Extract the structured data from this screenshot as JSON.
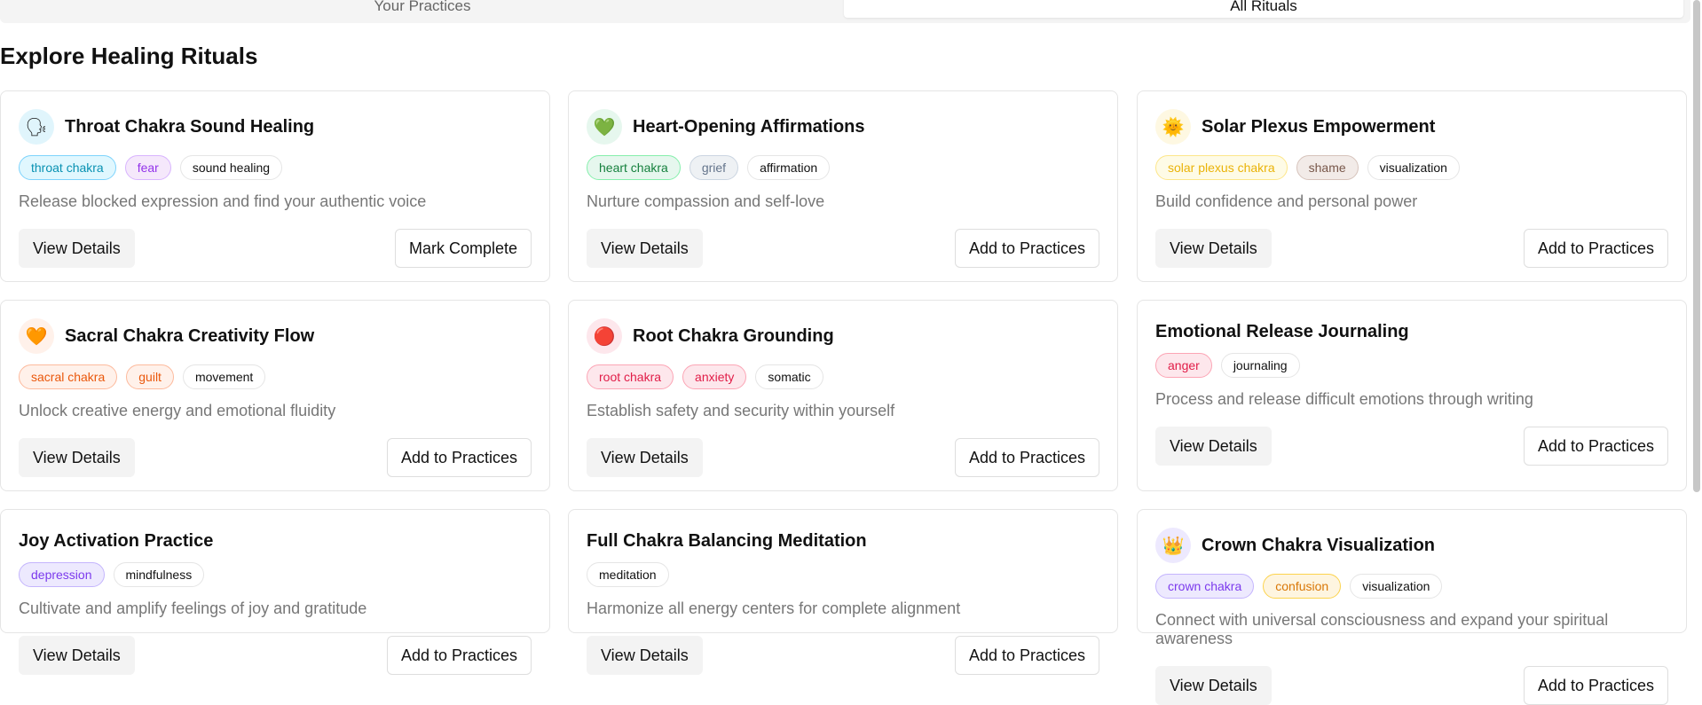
{
  "tabs": {
    "practices": "Your Practices",
    "all": "All Rituals"
  },
  "page": {
    "title": "Explore Healing Rituals"
  },
  "colors": {
    "blue_bg": "#e0f7fe",
    "blue_border": "#7dd3fc",
    "blue_text": "#0891b2",
    "purple_bg": "#f5e8fb",
    "purple_border": "#d8b4fe",
    "purple_text": "#9333ea",
    "green_bg": "#e6f7ee",
    "green_border": "#86efac",
    "green_text": "#15803d",
    "gray_bg": "#eef1f4",
    "gray_border": "#cbd5e1",
    "gray_text": "#64748b",
    "yellow_bg": "#fefbe6",
    "yellow_border": "#fde68a",
    "yellow_text": "#eab308",
    "brown_bg": "#f2ebe8",
    "brown_border": "#d6c3bb",
    "brown_text": "#78574a",
    "orange_bg": "#fff1ea",
    "orange_border": "#fdba9d",
    "orange_text": "#ea580c",
    "red_bg": "#fde7ec",
    "red_border": "#fca5b5",
    "red_text": "#e11d48",
    "indigo_bg": "#ede9fe",
    "indigo_border": "#c4b5fd",
    "indigo_text": "#7c3aed",
    "amber_bg": "#fef5e0",
    "amber_border": "#fcd34d",
    "amber_text": "#d97706"
  },
  "cards": [
    {
      "title": "Throat Chakra Sound Healing",
      "icon": "speaking-head-icon",
      "icon_glyph": "🗣",
      "icon_bg": "#e0f5fc",
      "tags": [
        {
          "label": "throat chakra",
          "style": "blue"
        },
        {
          "label": "fear",
          "style": "purple"
        },
        {
          "label": "sound healing",
          "style": "plain"
        }
      ],
      "description": "Release blocked expression and find your authentic voice",
      "view_label": "View Details",
      "action_label": "Mark Complete"
    },
    {
      "title": "Heart-Opening Affirmations",
      "icon": "green-heart-icon",
      "icon_glyph": "💚",
      "icon_bg": "#e6f7ee",
      "tags": [
        {
          "label": "heart chakra",
          "style": "green"
        },
        {
          "label": "grief",
          "style": "gray"
        },
        {
          "label": "affirmation",
          "style": "plain"
        }
      ],
      "description": "Nurture compassion and self-love",
      "view_label": "View Details",
      "action_label": "Add to Practices"
    },
    {
      "title": "Solar Plexus Empowerment",
      "icon": "sun-icon",
      "icon_glyph": "🌞",
      "icon_bg": "#fef8e2",
      "tags": [
        {
          "label": "solar plexus chakra",
          "style": "yellow"
        },
        {
          "label": "shame",
          "style": "brown"
        },
        {
          "label": "visualization",
          "style": "plain"
        }
      ],
      "description": "Build confidence and personal power",
      "view_label": "View Details",
      "action_label": "Add to Practices"
    },
    {
      "title": "Sacral Chakra Creativity Flow",
      "icon": "orange-heart-icon",
      "icon_glyph": "🧡",
      "icon_bg": "#fff1ea",
      "tags": [
        {
          "label": "sacral chakra",
          "style": "orange"
        },
        {
          "label": "guilt",
          "style": "orange"
        },
        {
          "label": "movement",
          "style": "plain"
        }
      ],
      "description": "Unlock creative energy and emotional fluidity",
      "view_label": "View Details",
      "action_label": "Add to Practices"
    },
    {
      "title": "Root Chakra Grounding",
      "icon": "red-circle-icon",
      "icon_glyph": "🔴",
      "icon_bg": "#fde7ec",
      "tags": [
        {
          "label": "root chakra",
          "style": "red"
        },
        {
          "label": "anxiety",
          "style": "red"
        },
        {
          "label": "somatic",
          "style": "plain"
        }
      ],
      "description": "Establish safety and security within yourself",
      "view_label": "View Details",
      "action_label": "Add to Practices"
    },
    {
      "title": "Emotional Release Journaling",
      "icon": "",
      "icon_glyph": "",
      "icon_bg": "",
      "tags": [
        {
          "label": "anger",
          "style": "red"
        },
        {
          "label": "journaling",
          "style": "plain"
        }
      ],
      "description": "Process and release difficult emotions through writing",
      "view_label": "View Details",
      "action_label": "Add to Practices"
    },
    {
      "title": "Joy Activation Practice",
      "icon": "",
      "icon_glyph": "",
      "icon_bg": "",
      "tags": [
        {
          "label": "depression",
          "style": "indigo"
        },
        {
          "label": "mindfulness",
          "style": "plain"
        }
      ],
      "description": "Cultivate and amplify feelings of joy and gratitude",
      "view_label": "View Details",
      "action_label": "Add to Practices"
    },
    {
      "title": "Full Chakra Balancing Meditation",
      "icon": "",
      "icon_glyph": "",
      "icon_bg": "",
      "tags": [
        {
          "label": "meditation",
          "style": "plain"
        }
      ],
      "description": "Harmonize all energy centers for complete alignment",
      "view_label": "View Details",
      "action_label": "Add to Practices"
    },
    {
      "title": "Crown Chakra Visualization",
      "icon": "crown-icon",
      "icon_glyph": "👑",
      "icon_bg": "#ede9fe",
      "tags": [
        {
          "label": "crown chakra",
          "style": "indigo"
        },
        {
          "label": "confusion",
          "style": "amber"
        },
        {
          "label": "visualization",
          "style": "plain"
        }
      ],
      "description": "Connect with universal consciousness and expand your spiritual awareness",
      "view_label": "View Details",
      "action_label": "Add to Practices"
    }
  ]
}
